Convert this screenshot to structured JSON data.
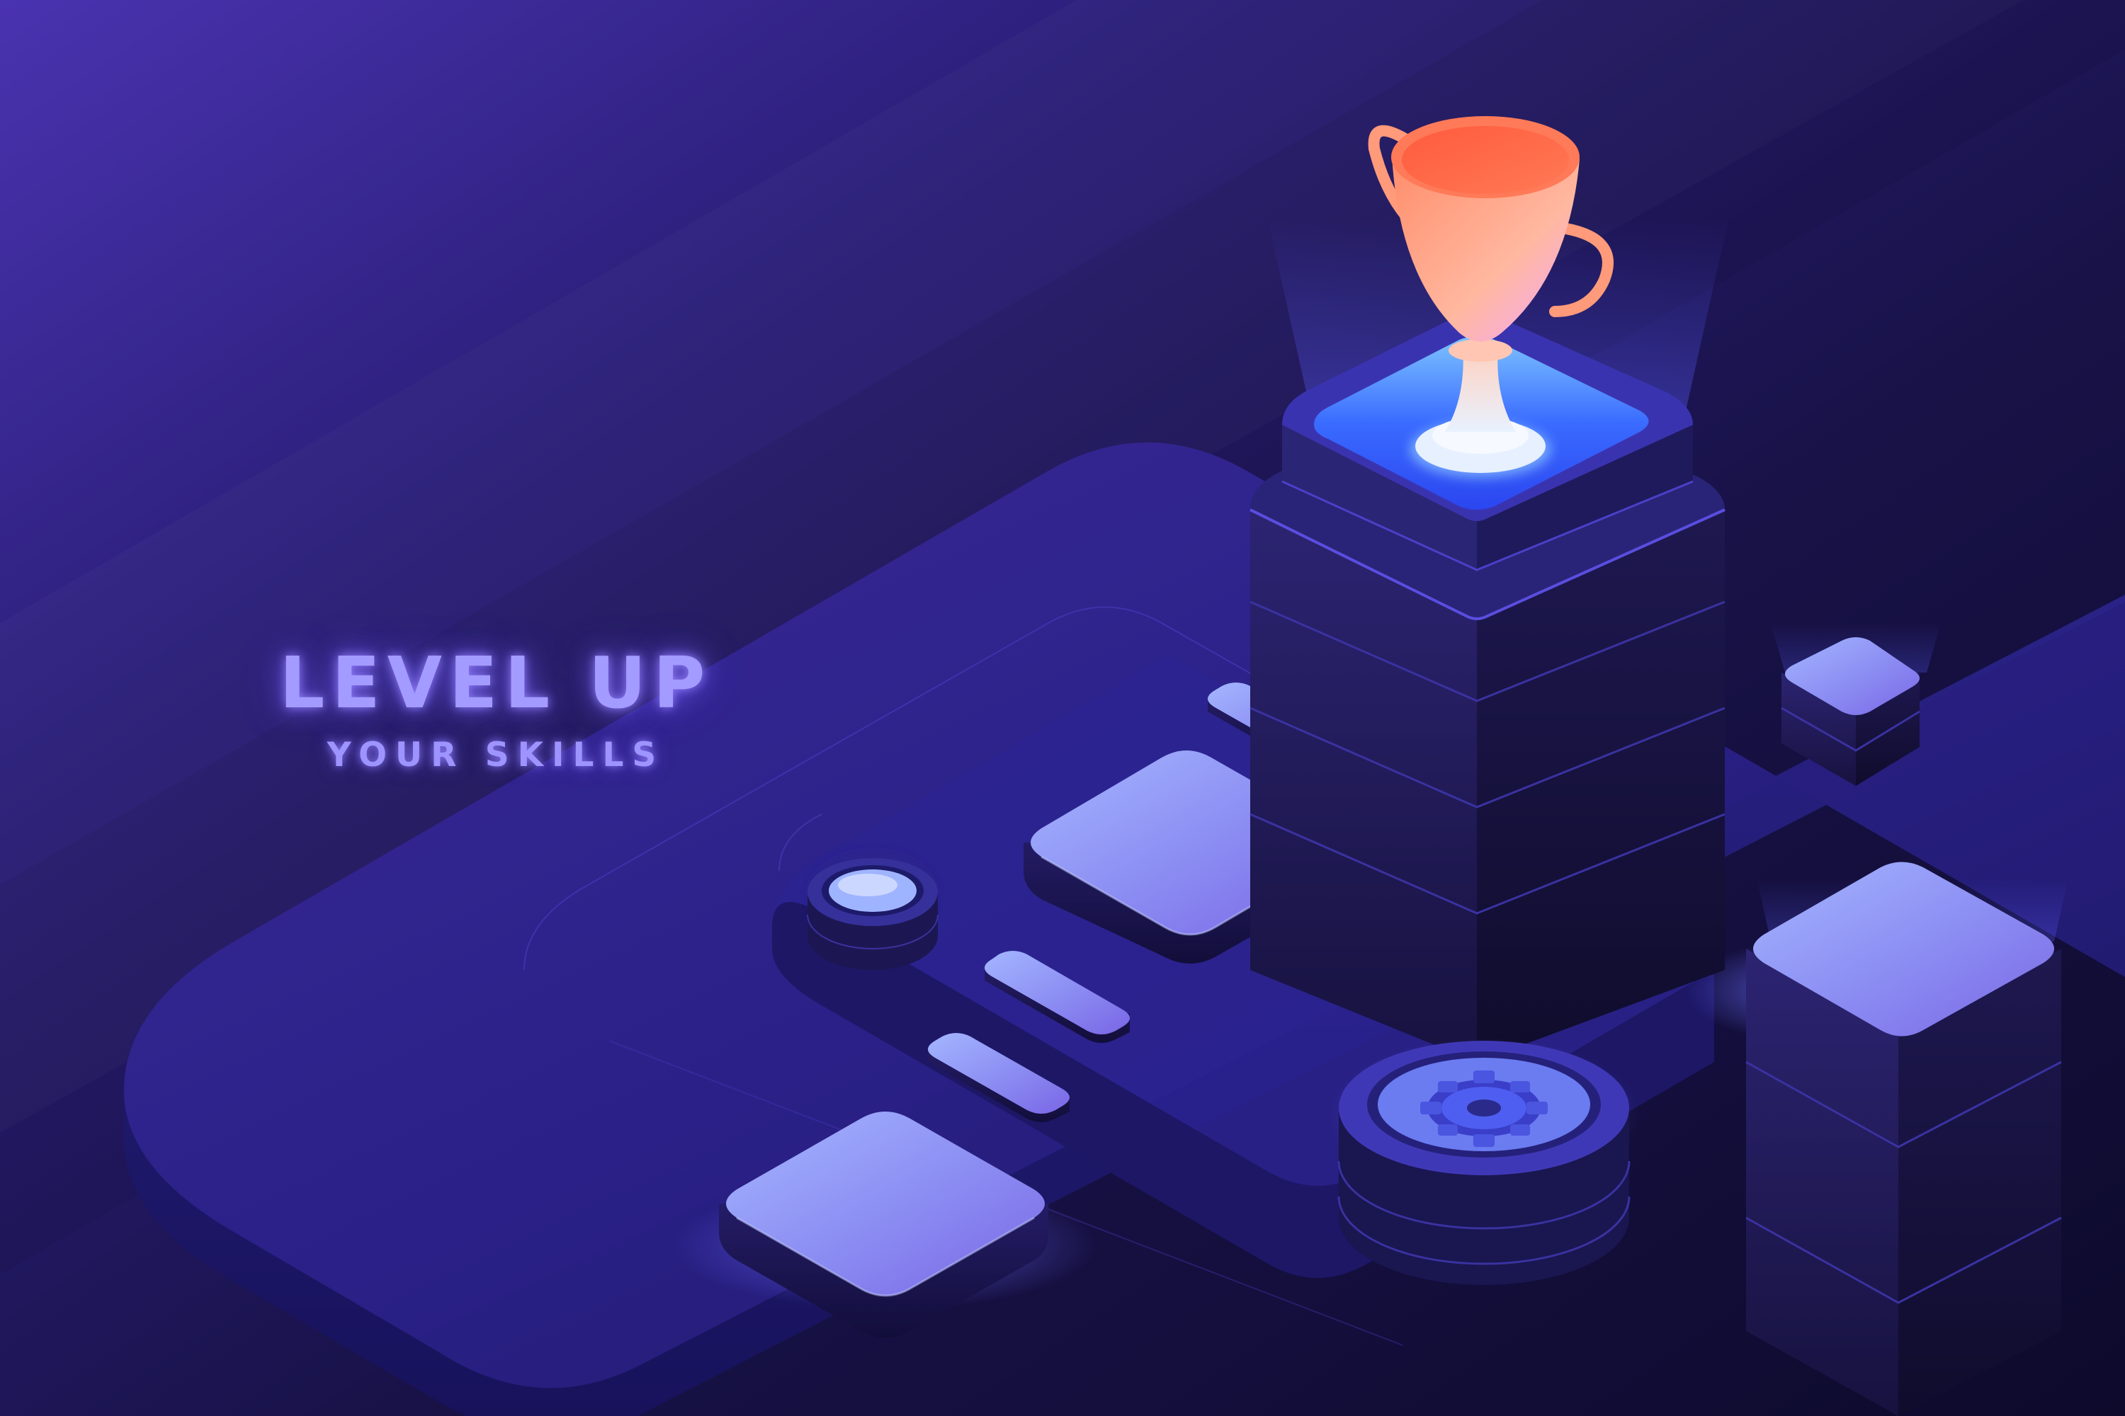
{
  "headline": {
    "title": "LEVEL UP",
    "subtitle": "YOUR SKILLS"
  },
  "colors": {
    "background": "#1a124d",
    "accent_glow": "#5b5bff",
    "trophy": "#ff6a4d",
    "tile_face": "#8b8cf2",
    "pillar_body": "#1b1646",
    "headline_text": "#a39bff"
  },
  "icons": {
    "trophy": "trophy-icon",
    "gear": "gear-icon"
  }
}
